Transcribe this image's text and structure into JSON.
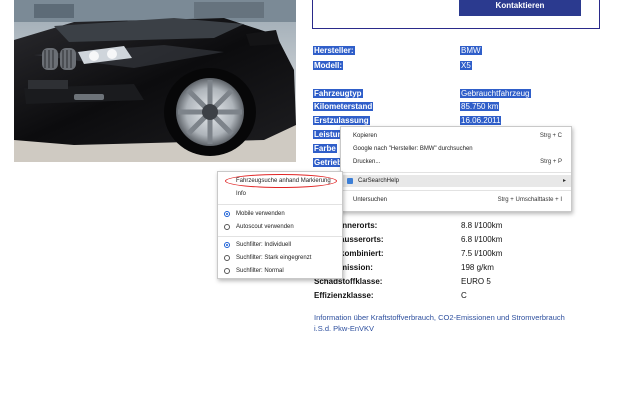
{
  "header": {
    "contact_label": "Kontaktieren"
  },
  "specs_top": [
    {
      "label": "Hersteller:",
      "value": "BMW"
    },
    {
      "label": "Modell:",
      "value": "X5"
    }
  ],
  "specs_mid": [
    {
      "label": "Fahrzeugtyp",
      "value": "Gebrauchtfahrzeug"
    },
    {
      "label": "Kilometerstand",
      "value": "85.750 km"
    },
    {
      "label": "Erstzulassung",
      "value": "16.06.2011"
    }
  ],
  "specs_partial": [
    "Leistung",
    "Farbe",
    "Getriebe"
  ],
  "specs_bottom": [
    {
      "label": "innerorts:",
      "value": "8.8 l/100km"
    },
    {
      "label": "ausserorts:",
      "value": "6.8 l/100km"
    },
    {
      "label": "kombiniert:",
      "value": "7.5 l/100km"
    },
    {
      "label": "mission:",
      "value": "198 g/km"
    },
    {
      "label": "Schadstoffklasse:",
      "value": "EURO 5"
    },
    {
      "label": "Effizienzklasse:",
      "value": "C"
    }
  ],
  "info_link": [
    "Information über Kraftstoffverbrauch, CO2-Emissionen und Stromverbrauch",
    "i.S.d. Pkw-EnVKV"
  ],
  "context_menu": {
    "copy": {
      "label": "Kopieren",
      "shortcut": "Strg + C"
    },
    "google": {
      "label": "Google nach \"Hersteller: BMW\" durchsuchen"
    },
    "print": {
      "label": "Drucken...",
      "shortcut": "Strg + P"
    },
    "carsearch": {
      "label": "CarSearchHelp",
      "arrow": "▸"
    },
    "inspect": {
      "label": "Untersuchen",
      "shortcut": "Strg + Umschalttaste + I"
    }
  },
  "submenu": {
    "search_marked": "Fahrzeugsuche anhand Markierung",
    "info": "Info",
    "mobile": "Mobile verwenden",
    "autoscout": "Autoscout verwenden",
    "filter_individual": "Suchfilter: Individuell",
    "filter_strong": "Suchfilter: Stark eingegrenzt",
    "filter_normal": "Suchfilter: Normal",
    "radio_selected": {
      "mobile": true,
      "autoscout": false,
      "filter_individual": true,
      "filter_strong": false,
      "filter_normal": false
    }
  },
  "colors": {
    "selection": "#2f5ec9",
    "button": "#2b3a8f",
    "highlight_ring": "#e02424",
    "link": "#2d4f9e"
  }
}
